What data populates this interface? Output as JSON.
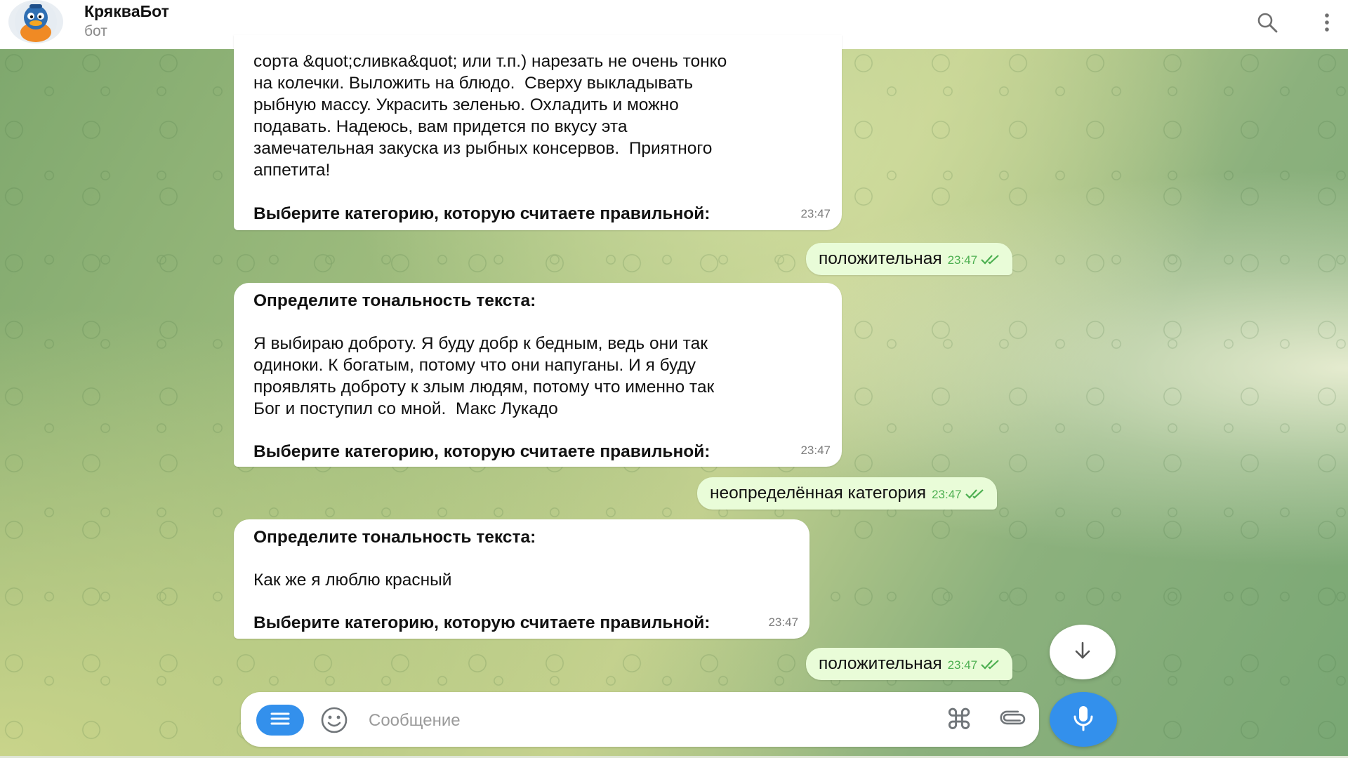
{
  "header": {
    "title": "КряквaБот",
    "status": "бот",
    "avatar_icon": "duck-avatar-icon",
    "search_icon": "search-icon",
    "menu_icon": "more-vertical-icon"
  },
  "messages": [
    {
      "direction": "incoming",
      "text": "сорта &quot;сливка&quot; или т.п.) нарезать не очень тонко\nна колечки. Выложить на блюдо.  Сверху выкладывать\nрыбную массу. Украсить зеленью. Охладить и можно\nподавать. Надеюсь, вам придется по вкусу эта\nзамечательная закуска из рыбных консервов.  Приятного\nаппетита!",
      "prompt": "Выберите категорию, которую считаете правильной:",
      "time": "23:47"
    },
    {
      "direction": "outgoing",
      "text": "положительная",
      "time": "23:47"
    },
    {
      "direction": "incoming",
      "heading": "Определите тональность текста:",
      "text": "Я выбираю доброту. Я буду добр к бедным, ведь они так\nодиноки. К богатым, потому что они напуганы. И я буду\nпроявлять доброту к злым людям, потому что именно так\nБог и поступил со мной.  Макс Лукадо",
      "prompt": "Выберите категорию, которую считаете правильной:",
      "time": "23:47"
    },
    {
      "direction": "outgoing",
      "text": "неопределённая категория",
      "time": "23:47"
    },
    {
      "direction": "incoming",
      "heading": "Определите тональность текста:",
      "text": "Как же я люблю красный",
      "prompt": "Выберите категорию, которую считаете правильной:",
      "time": "23:47"
    },
    {
      "direction": "outgoing",
      "text": "положительная",
      "time": "23:47"
    }
  ],
  "composer": {
    "placeholder": "Сообщение",
    "value": "",
    "menu_icon": "bot-menu-icon",
    "emoji_icon": "emoji-icon",
    "command_icon": "command-icon",
    "attach_icon": "paperclip-icon",
    "mic_icon": "microphone-icon"
  },
  "scroll_down_icon": "arrow-down-icon",
  "colors": {
    "accent": "#3390ec",
    "outgoing_bubble": "#e9fcd8",
    "read_check": "#4caf50"
  }
}
